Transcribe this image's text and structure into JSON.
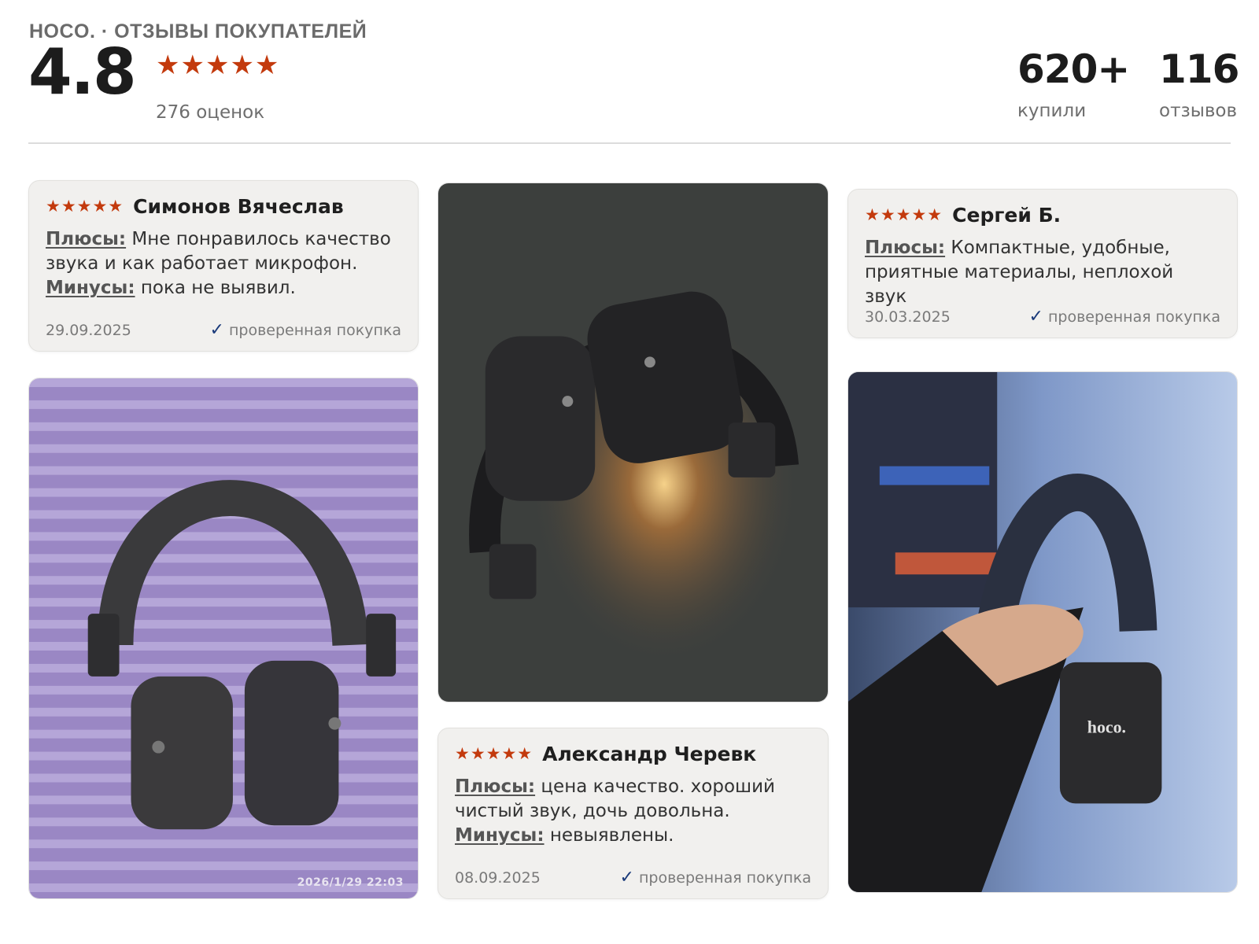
{
  "header": {
    "brand_line": "HOCO. · ОТЗЫВЫ ПОКУПАТЕЛЕЙ",
    "rating_value": "4.8",
    "stars": "★★★★★",
    "rating_count": "276 оценок",
    "stats": [
      {
        "value": "620+",
        "label": "купили"
      },
      {
        "value": "116",
        "label": "отзывов"
      }
    ],
    "star_color": "#c33a0d"
  },
  "reviews": [
    {
      "stars": "★★★★★",
      "author": "Симонов Вячеслав",
      "pros_label": "Плюсы:",
      "pros": "Мне понравилось качество звука и как работает микрофон.",
      "cons_label": "Минусы:",
      "cons": "пока не выявил.",
      "date": "29.09.2025",
      "verified": "проверенная покупка"
    },
    {
      "stars": "★★★★★",
      "author": "Сергей Б.",
      "pros_label": "Плюсы:",
      "pros": "Компактные, удобные, приятные материалы, неплохой звук",
      "date": "30.03.2025",
      "verified": "проверенная покупка"
    },
    {
      "stars": "★★★★★",
      "author": "Александр Черевк",
      "pros_label": "Плюсы:",
      "pros": "цена качество. хороший чистый звук, дочь довольна.",
      "cons_label": "Минусы:",
      "cons": "невыявлены.",
      "date": "08.09.2025",
      "verified": "проверенная покупка"
    }
  ],
  "photos": {
    "purple_stamp": "2026/1/29 22:03",
    "hand_logo": "hoco."
  },
  "icons": {
    "verified": "checkmark-icon",
    "star": "star-icon"
  }
}
